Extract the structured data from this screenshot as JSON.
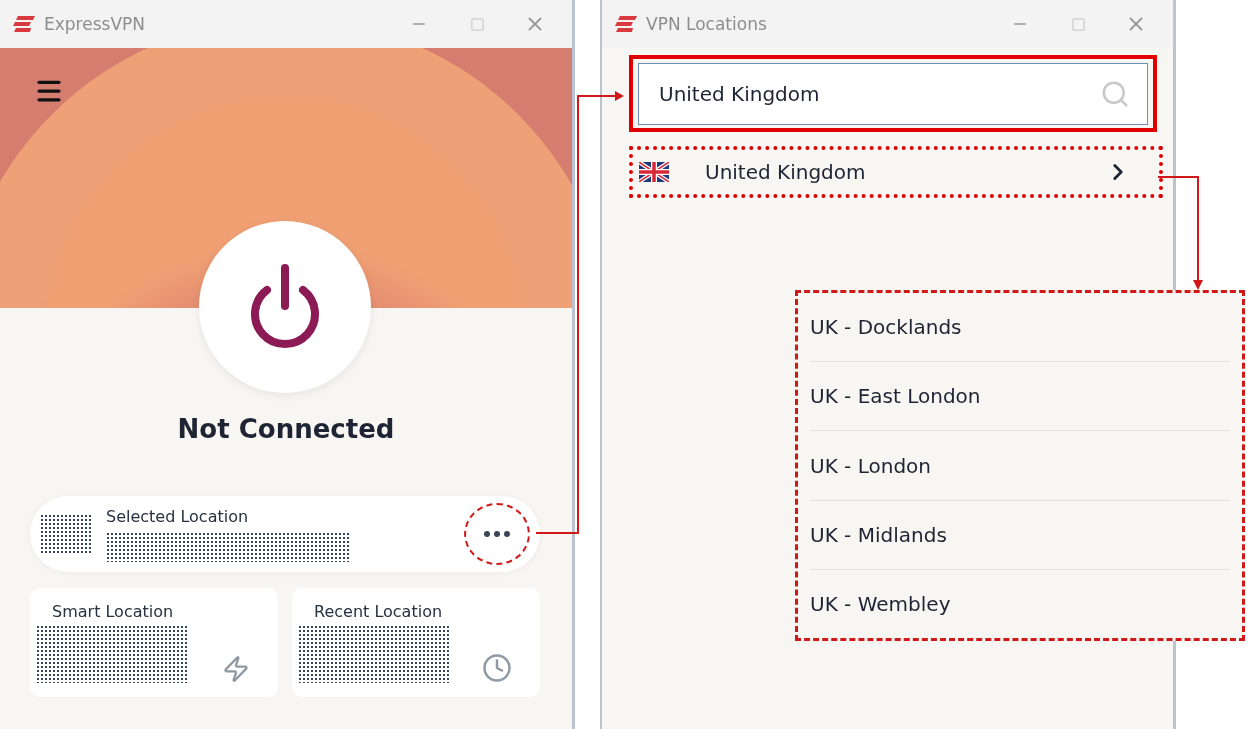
{
  "main_window": {
    "title": "ExpressVPN",
    "status": "Not Connected",
    "selected_location": {
      "label": "Selected Location"
    },
    "quick_locations": [
      {
        "label": "Smart Location",
        "kind": "smart"
      },
      {
        "label": "Recent Location",
        "kind": "recent"
      }
    ]
  },
  "locations_window": {
    "title": "VPN Locations",
    "search": {
      "value": "United Kingdom"
    },
    "results": [
      {
        "label": "United Kingdom"
      }
    ]
  },
  "sub_locations": [
    {
      "label": "UK - Docklands"
    },
    {
      "label": "UK - East London"
    },
    {
      "label": "UK - London"
    },
    {
      "label": "UK - Midlands"
    },
    {
      "label": "UK - Wembley"
    }
  ]
}
